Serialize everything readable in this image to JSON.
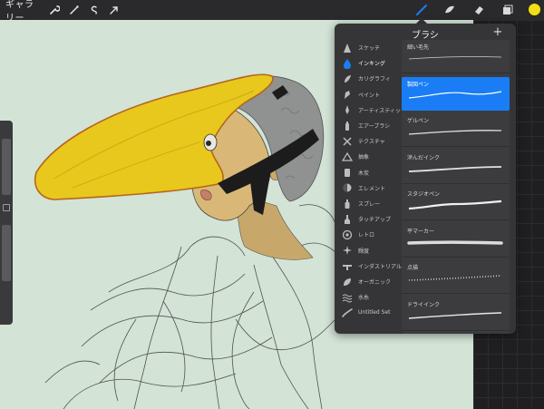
{
  "toolbar": {
    "gallery_label": "ギャラリー",
    "left_tools": [
      "wrench-icon",
      "magic-wand-icon",
      "selection-icon",
      "transform-arrow-icon"
    ],
    "right_tools": [
      "brush-icon",
      "smudge-icon",
      "eraser-icon",
      "layers-icon"
    ],
    "active_tool": "brush-icon",
    "color": "#f4e010"
  },
  "brush_library": {
    "title": "ブラシ",
    "add_label": "+",
    "categories": [
      {
        "label": "スケッチ",
        "icon": "sketch-icon"
      },
      {
        "label": "インキング",
        "icon": "ink-drop-icon",
        "active": true
      },
      {
        "label": "カリグラフィ",
        "icon": "calligraphy-icon"
      },
      {
        "label": "ペイント",
        "icon": "paint-icon"
      },
      {
        "label": "アーティスティック",
        "icon": "artistic-icon"
      },
      {
        "label": "エアーブラシ",
        "icon": "airbrush-icon"
      },
      {
        "label": "テクスチャ",
        "icon": "texture-icon"
      },
      {
        "label": "抽象",
        "icon": "abstract-icon"
      },
      {
        "label": "木炭",
        "icon": "charcoal-icon"
      },
      {
        "label": "エレメント",
        "icon": "element-icon"
      },
      {
        "label": "スプレー",
        "icon": "spray-icon"
      },
      {
        "label": "タッチアップ",
        "icon": "touchup-icon"
      },
      {
        "label": "レトロ",
        "icon": "retro-icon"
      },
      {
        "label": "輝度",
        "icon": "luminance-icon"
      },
      {
        "label": "インダストリアル",
        "icon": "industrial-icon"
      },
      {
        "label": "オーガニック",
        "icon": "organic-icon"
      },
      {
        "label": "水糸",
        "icon": "water-icon"
      },
      {
        "label": "Untitled Set",
        "icon": "untitled-set-icon"
      }
    ],
    "brushes": [
      {
        "name": "細い毛先"
      },
      {
        "name": "製図ペン",
        "selected": true
      },
      {
        "name": "ゲルペン"
      },
      {
        "name": "滲んだインク"
      },
      {
        "name": "スタジオペン"
      },
      {
        "name": "平マーカー"
      },
      {
        "name": "点描"
      },
      {
        "name": "ドライインク"
      }
    ],
    "accent": "#1a7df5"
  }
}
